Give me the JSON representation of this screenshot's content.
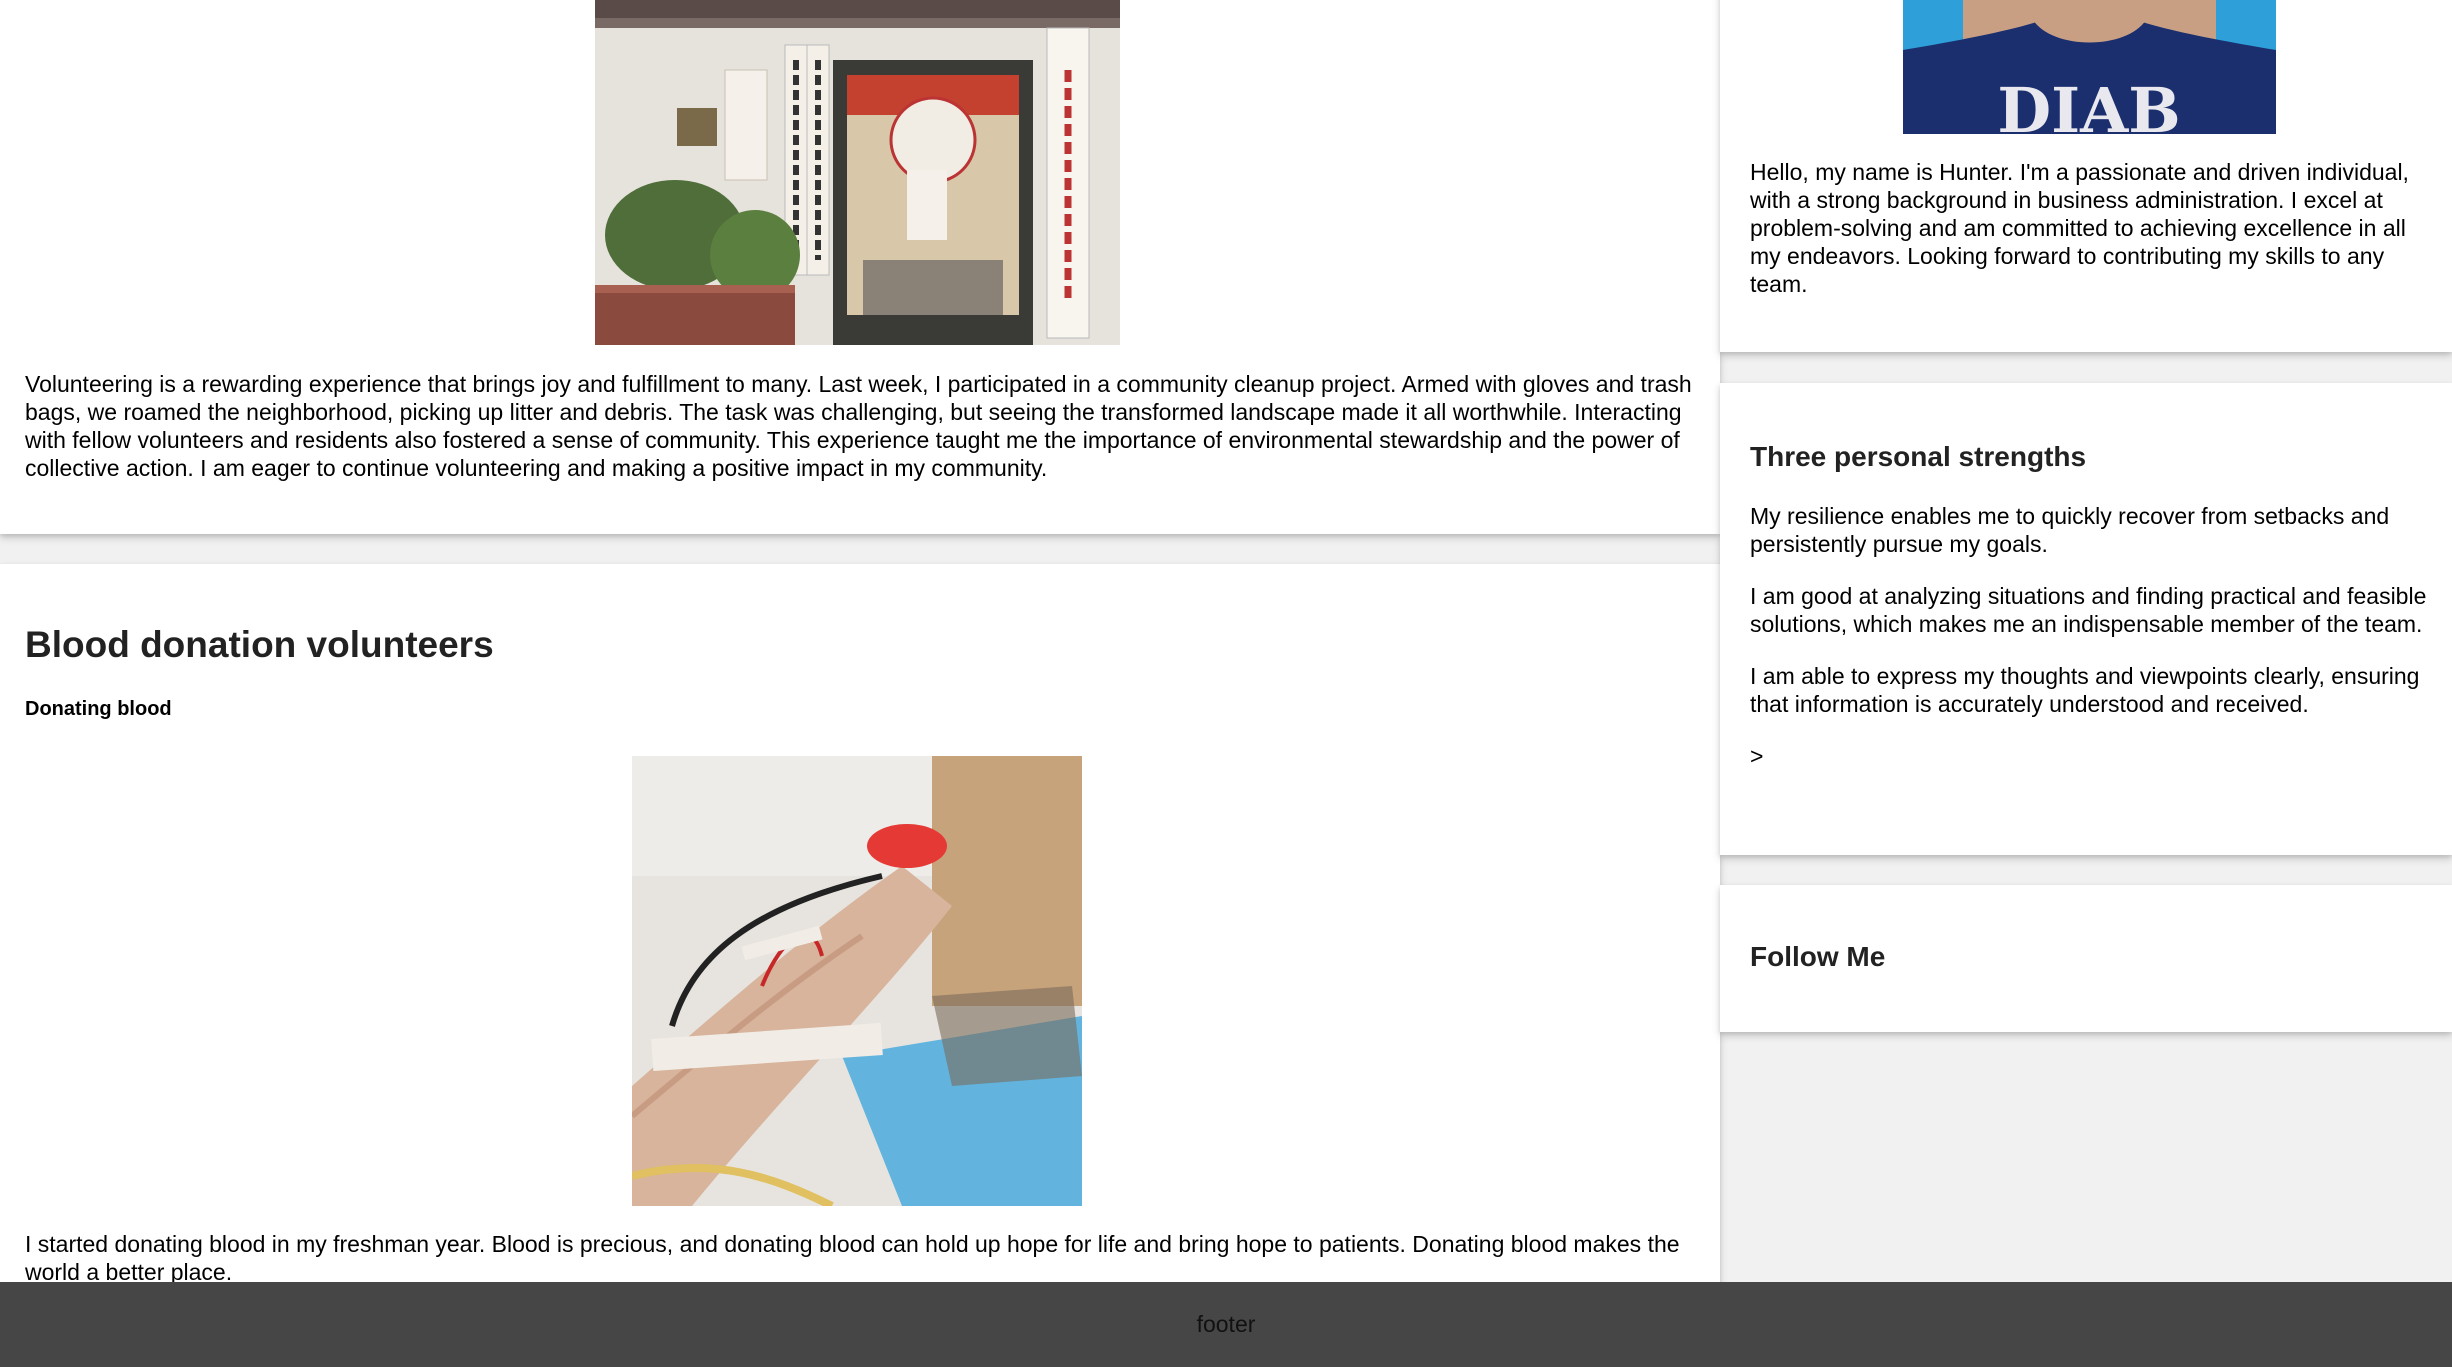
{
  "community": {
    "photo_alt": "Community residents committee entrance",
    "text": "Volunteering is a rewarding experience that brings joy and fulfillment to many. Last week, I participated in a community cleanup project. Armed with gloves and trash bags, we roamed the neighborhood, picking up litter and debris. The task was challenging, but seeing the transformed landscape made it all worthwhile. Interacting with fellow volunteers and residents also fostered a sense of community. This experience taught me the importance of environmental stewardship and the power of collective action. I am eager to continue volunteering and making a positive impact in my community."
  },
  "blood": {
    "title": "Blood donation volunteers",
    "subtitle": "Donating blood",
    "photo_alt": "Arm donating blood",
    "text": "I started donating blood in my freshman year. Blood is precious, and donating blood can hold up hope for life and bring hope to patients. Donating blood makes the world a better place."
  },
  "about": {
    "avatar_alt": "Portrait of Hunter",
    "shirt_text": "DIAB",
    "text": "Hello, my name is Hunter. I'm a passionate and driven individual, with a strong background in business administration. I excel at problem-solving and am committed to achieving excellence in all my endeavors. Looking forward to contributing my skills to any team."
  },
  "strengths": {
    "title": "Three personal strengths",
    "items": [
      "My resilience enables me to quickly recover from setbacks and persistently pursue my goals.",
      "I am good at analyzing situations and finding practical and feasible solutions, which makes me an indispensable member of the team.",
      "I am able to express my thoughts and viewpoints clearly, ensuring that information is accurately understood and received."
    ],
    "trailing": ">"
  },
  "follow": {
    "title": "Follow Me"
  },
  "footer": {
    "text": "footer"
  },
  "colors": {
    "footer_bg": "#464646",
    "page_bg": "#f1f1f1",
    "card_bg": "#ffffff"
  }
}
